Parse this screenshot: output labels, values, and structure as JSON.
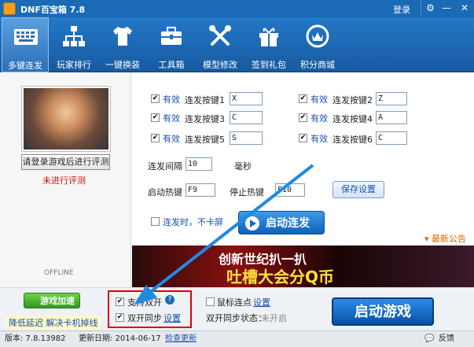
{
  "titlebar": {
    "title": "DNF百宝箱 7.8",
    "login": "登录",
    "settings_icon": "gear-icon",
    "minimize": "—",
    "close": "✕"
  },
  "toolbar": [
    {
      "label": "多键连发",
      "icon": "keyboard-icon"
    },
    {
      "label": "玩家排行",
      "icon": "hierarchy-icon"
    },
    {
      "label": "一键换装",
      "icon": "shirt-icon"
    },
    {
      "label": "工具箱",
      "icon": "toolbox-icon"
    },
    {
      "label": "模型修改",
      "icon": "wrench-icon"
    },
    {
      "label": "签到礼包",
      "icon": "gift-icon"
    },
    {
      "label": "积分商城",
      "icon": "shop-icon"
    }
  ],
  "left": {
    "login_eval": "请登录游戏后进行评测",
    "not_eval": "未进行评测",
    "offline": "OFFLINE"
  },
  "keys": [
    {
      "enabled": "有效",
      "label": "连发按键1",
      "value": "X"
    },
    {
      "enabled": "有效",
      "label": "连发按键2",
      "value": "Z"
    },
    {
      "enabled": "有效",
      "label": "连发按键3",
      "value": "C"
    },
    {
      "enabled": "有效",
      "label": "连发按键4",
      "value": "A"
    },
    {
      "enabled": "有效",
      "label": "连发按键5",
      "value": "S"
    },
    {
      "enabled": "有效",
      "label": "连发按键6",
      "value": "C"
    }
  ],
  "interval": {
    "label": "连发间隔",
    "value": "10",
    "unit": "毫秒"
  },
  "hotkeys": {
    "start_label": "启动热键",
    "start_value": "F9",
    "stop_label": "停止热键",
    "stop_value": "F10",
    "save": "保存设置"
  },
  "no_lag": "连发时，不卡屏",
  "start_combo": "启动连发",
  "news": "最新公告",
  "banner": {
    "line1": "创新世纪扒一扒",
    "line2": "吐槽大会分Q币"
  },
  "bottom": {
    "game_acc": "游戏加速",
    "lag_text": "降低延迟 解决卡机掉线",
    "dual_support": "支持双开",
    "dual_sync": "双开同步",
    "dual_sync_settings": "设置",
    "mouse_click": "鼠标连点",
    "mouse_settings": "设置",
    "dual_status_label": "双开同步状态：",
    "dual_status_value": "未开启",
    "launch": "启动游戏"
  },
  "statusbar": {
    "version": "版本: 7.8.13982",
    "update_date": "更新日期: 2014-06-17",
    "check_update": "检查更新",
    "feedback": "反馈"
  }
}
